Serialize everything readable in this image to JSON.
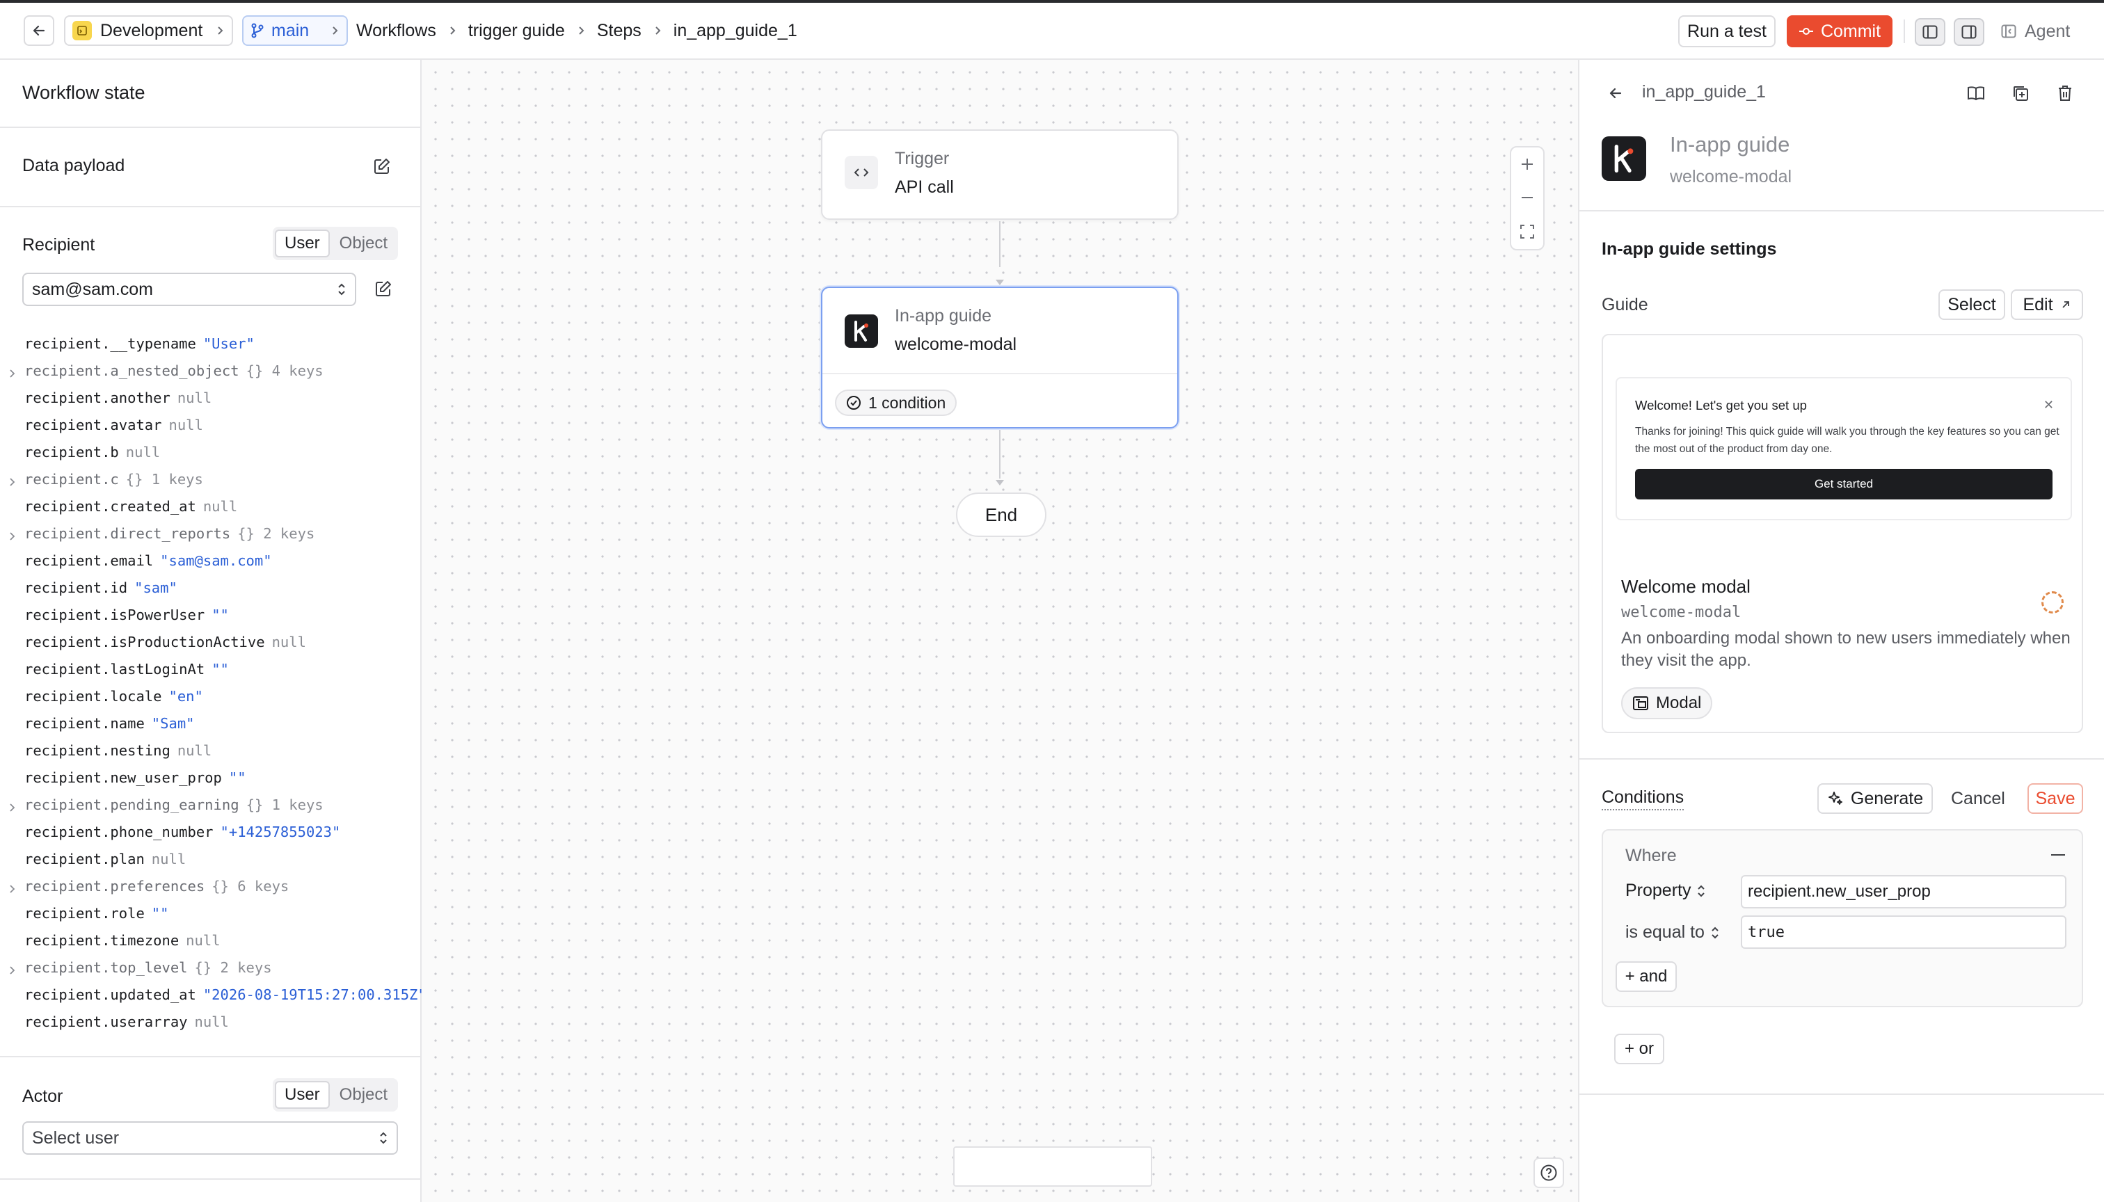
{
  "topbar": {
    "environment": "Development",
    "branch": "main",
    "breadcrumbs": [
      "Workflows",
      "trigger guide",
      "Steps",
      "in_app_guide_1"
    ],
    "run_test": "Run a test",
    "commit": "Commit",
    "agent": "Agent",
    "commit_color": "#ea4b2f"
  },
  "left": {
    "title": "Workflow state",
    "payload_label": "Data payload",
    "recipient_label": "Recipient",
    "recipient_tabs": [
      "User",
      "Object"
    ],
    "recipient_value": "sam@sam.com",
    "properties": [
      {
        "key": "recipient.__typename",
        "value": "\"User\"",
        "kind": "str"
      },
      {
        "key": "recipient.a_nested_object",
        "value": "{} 4 keys",
        "kind": "obj"
      },
      {
        "key": "recipient.another",
        "value": "null",
        "kind": "null"
      },
      {
        "key": "recipient.avatar",
        "value": "null",
        "kind": "null"
      },
      {
        "key": "recipient.b",
        "value": "null",
        "kind": "null"
      },
      {
        "key": "recipient.c",
        "value": "{} 1 keys",
        "kind": "obj"
      },
      {
        "key": "recipient.created_at",
        "value": "null",
        "kind": "null"
      },
      {
        "key": "recipient.direct_reports",
        "value": "{} 2 keys",
        "kind": "obj"
      },
      {
        "key": "recipient.email",
        "value": "\"sam@sam.com\"",
        "kind": "str"
      },
      {
        "key": "recipient.id",
        "value": "\"sam\"",
        "kind": "str"
      },
      {
        "key": "recipient.isPowerUser",
        "value": "\"\"",
        "kind": "str"
      },
      {
        "key": "recipient.isProductionActive",
        "value": "null",
        "kind": "null"
      },
      {
        "key": "recipient.lastLoginAt",
        "value": "\"\"",
        "kind": "str"
      },
      {
        "key": "recipient.locale",
        "value": "\"en\"",
        "kind": "str"
      },
      {
        "key": "recipient.name",
        "value": "\"Sam\"",
        "kind": "str"
      },
      {
        "key": "recipient.nesting",
        "value": "null",
        "kind": "null"
      },
      {
        "key": "recipient.new_user_prop",
        "value": "\"\"",
        "kind": "str"
      },
      {
        "key": "recipient.pending_earning",
        "value": "{} 1 keys",
        "kind": "obj"
      },
      {
        "key": "recipient.phone_number",
        "value": "\"+14257855023\"",
        "kind": "str"
      },
      {
        "key": "recipient.plan",
        "value": "null",
        "kind": "null"
      },
      {
        "key": "recipient.preferences",
        "value": "{} 6 keys",
        "kind": "obj"
      },
      {
        "key": "recipient.role",
        "value": "\"\"",
        "kind": "str"
      },
      {
        "key": "recipient.timezone",
        "value": "null",
        "kind": "null"
      },
      {
        "key": "recipient.top_level",
        "value": "{} 2 keys",
        "kind": "obj"
      },
      {
        "key": "recipient.updated_at",
        "value": "\"2026-08-19T15:27:00.315Z\"",
        "kind": "str"
      },
      {
        "key": "recipient.userarray",
        "value": "null",
        "kind": "null"
      }
    ],
    "actor_label": "Actor",
    "actor_tabs": [
      "User",
      "Object"
    ],
    "actor_placeholder": "Select user"
  },
  "canvas": {
    "trigger": {
      "kind": "Trigger",
      "name": "API call"
    },
    "guide": {
      "kind": "In-app guide",
      "name": "welcome-modal",
      "conditions": "1 condition"
    },
    "end": "End"
  },
  "right": {
    "step_name": "in_app_guide_1",
    "kind": "In-app guide",
    "key": "welcome-modal",
    "settings_title": "In-app guide settings",
    "guide_label": "Guide",
    "select": "Select",
    "edit": "Edit",
    "preview": {
      "title": "Welcome! Let's get you set up",
      "body": "Thanks for joining! This quick guide will walk you through the key features so you can get the most out of the product from day one.",
      "button": "Get started"
    },
    "guide_name": "Welcome modal",
    "guide_key": "welcome-modal",
    "guide_desc": "An onboarding modal shown to new users immediately when they visit the app.",
    "guide_type": "Modal",
    "conditions_title": "Conditions",
    "generate": "Generate",
    "cancel": "Cancel",
    "save": "Save",
    "where": "Where",
    "property_label": "Property",
    "property_value": "recipient.new_user_prop",
    "operator": "is equal to",
    "value": "true",
    "and": "+ and",
    "or": "+ or"
  }
}
